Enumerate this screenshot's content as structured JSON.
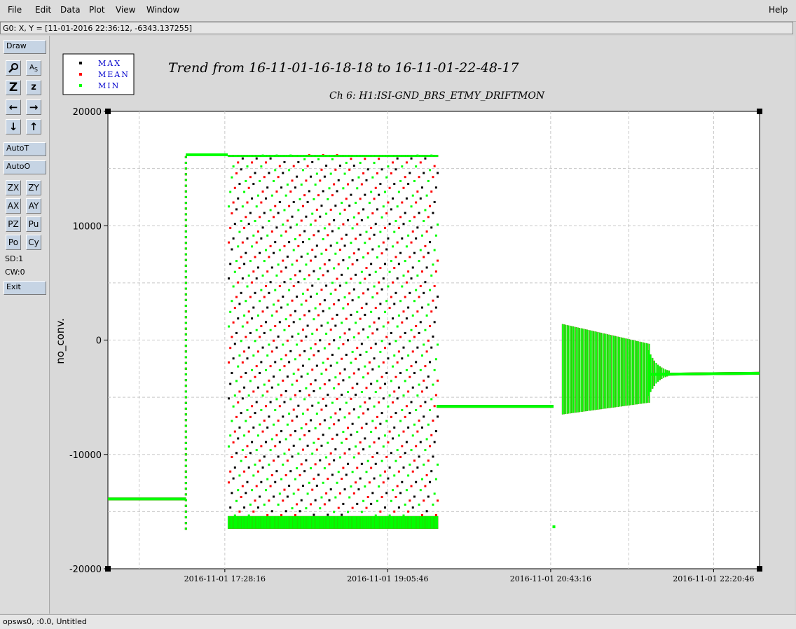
{
  "menu": {
    "file": "File",
    "edit": "Edit",
    "data": "Data",
    "plot": "Plot",
    "view": "View",
    "window": "Window",
    "help": "Help"
  },
  "status": "G0: X, Y = [11-01-2016 22:36:12, -6343.137255]",
  "toolbar": {
    "draw": "Draw",
    "zoom_big": "Z",
    "zoom_small": "z",
    "autot": "AutoT",
    "autoo": "AutoO",
    "zx": "ZX",
    "zy": "ZY",
    "ax": "AX",
    "ay": "AY",
    "pz": "PZ",
    "pu": "Pu",
    "po": "Po",
    "cy": "Cy",
    "sd": "SD:1",
    "cw": "CW:0",
    "exit": "Exit",
    "icons": [
      "magnifier-icon",
      "axis-scale-icon",
      "zoom-in-icon",
      "zoom-out-icon",
      "arrow-left-icon",
      "arrow-right-icon",
      "arrow-down-icon",
      "arrow-up-icon"
    ]
  },
  "footer": "opsws0, :0.0, Untitled",
  "colors": {
    "max": "#000000",
    "mean": "#ff0000",
    "min": "#00ff00",
    "legend_text": "#0000cc"
  },
  "chart_data": {
    "type": "scatter",
    "title": "Trend from 16-11-01-16-18-18 to 16-11-01-22-48-17",
    "subtitle": "Ch 6: H1:ISI-GND_BRS_ETMY_DRIFTMON",
    "xlabel": "",
    "ylabel": "no_conv.",
    "ylim": [
      -20000,
      20000
    ],
    "xlim": [
      "2016-11-01 16:18:18",
      "2016-11-01 22:48:17"
    ],
    "yticks": [
      "20000",
      "10000",
      "0",
      "-10000",
      "-20000"
    ],
    "xticks": [
      "2016-11-01 17:28:16",
      "2016-11-01 19:05:46",
      "2016-11-01 20:43:16",
      "2016-11-01 22:20:46"
    ],
    "grid": true,
    "legend_position": "top-left",
    "series": [
      {
        "name": "MAX",
        "segments": [
          {
            "kind": "flat",
            "x": [
              "2016-11-01 16:18:18",
              "2016-11-01 17:05:00"
            ],
            "y": -13900
          },
          {
            "kind": "spike",
            "x": "2016-11-01 17:05:00",
            "y": [
              -16500,
              16200
            ]
          },
          {
            "kind": "flat",
            "x": [
              "2016-11-01 17:05:00",
              "2016-11-01 17:30:00"
            ],
            "y": 16200
          },
          {
            "kind": "oscillation",
            "x": [
              "2016-11-01 17:30:00",
              "2016-11-01 19:35:00"
            ],
            "y": [
              -16500,
              16200
            ]
          },
          {
            "kind": "flat",
            "x": [
              "2016-11-01 19:35:00",
              "2016-11-01 20:45:00"
            ],
            "y": -5800
          },
          {
            "kind": "oscillation",
            "x": [
              "2016-11-01 20:50:00",
              "2016-11-01 21:42:00"
            ],
            "y": [
              -6500,
              1400
            ]
          },
          {
            "kind": "decay",
            "x": [
              "2016-11-01 21:42:00",
              "2016-11-01 22:48:17"
            ],
            "y": -2900
          }
        ]
      },
      {
        "name": "MEAN",
        "segments": [
          {
            "kind": "flat",
            "x": [
              "2016-11-01 16:18:18",
              "2016-11-01 17:05:00"
            ],
            "y": -13900
          },
          {
            "kind": "spike",
            "x": "2016-11-01 17:05:00",
            "y": [
              -16500,
              16200
            ]
          },
          {
            "kind": "flat",
            "x": [
              "2016-11-01 17:05:00",
              "2016-11-01 17:30:00"
            ],
            "y": 16200
          },
          {
            "kind": "oscillation",
            "x": [
              "2016-11-01 17:30:00",
              "2016-11-01 19:35:00"
            ],
            "y": [
              -16500,
              16200
            ]
          },
          {
            "kind": "flat",
            "x": [
              "2016-11-01 19:35:00",
              "2016-11-01 20:45:00"
            ],
            "y": -5800
          },
          {
            "kind": "oscillation",
            "x": [
              "2016-11-01 20:50:00",
              "2016-11-01 21:42:00"
            ],
            "y": [
              -6500,
              1400
            ]
          },
          {
            "kind": "decay",
            "x": [
              "2016-11-01 21:42:00",
              "2016-11-01 22:48:17"
            ],
            "y": -2900
          }
        ]
      },
      {
        "name": "MIN",
        "segments": [
          {
            "kind": "flat",
            "x": [
              "2016-11-01 16:18:18",
              "2016-11-01 17:05:00"
            ],
            "y": -13900
          },
          {
            "kind": "spike",
            "x": "2016-11-01 17:05:00",
            "y": [
              -16500,
              16200
            ]
          },
          {
            "kind": "flat",
            "x": [
              "2016-11-01 17:05:00",
              "2016-11-01 17:30:00"
            ],
            "y": 16200
          },
          {
            "kind": "oscillation",
            "x": [
              "2016-11-01 17:30:00",
              "2016-11-01 19:35:00"
            ],
            "y": [
              -16500,
              16200
            ]
          },
          {
            "kind": "flat",
            "x": [
              "2016-11-01 19:35:00",
              "2016-11-01 20:45:00"
            ],
            "y": -5800
          },
          {
            "kind": "outlier",
            "x": "2016-11-01 20:45:00",
            "y": -16300
          },
          {
            "kind": "oscillation",
            "x": [
              "2016-11-01 20:50:00",
              "2016-11-01 21:42:00"
            ],
            "y": [
              -6500,
              1400
            ]
          },
          {
            "kind": "decay",
            "x": [
              "2016-11-01 21:42:00",
              "2016-11-01 22:48:17"
            ],
            "y": -2900
          }
        ]
      }
    ]
  }
}
